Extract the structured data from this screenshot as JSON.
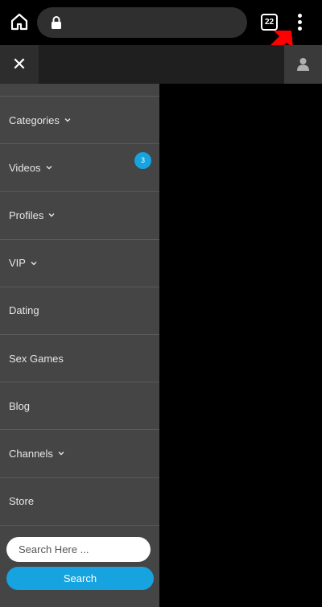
{
  "browser": {
    "tab_count": "22",
    "home_icon": "home-icon",
    "lock_icon": "lock-icon",
    "menu_icon": "more-vertical-icon",
    "annotation": "red-arrow-pointer"
  },
  "header": {
    "close_label": "✕",
    "user_icon": "user-icon"
  },
  "menu": {
    "items": [
      {
        "label": "Categories",
        "dropdown": true
      },
      {
        "label": "Videos",
        "dropdown": true,
        "badge": "3"
      },
      {
        "label": "Profiles",
        "dropdown": true
      },
      {
        "label": "VIP",
        "dropdown": true
      },
      {
        "label": "Dating",
        "dropdown": false
      },
      {
        "label": "Sex Games",
        "dropdown": false
      },
      {
        "label": "Blog",
        "dropdown": false
      },
      {
        "label": "Channels",
        "dropdown": true
      },
      {
        "label": "Store",
        "dropdown": false
      }
    ]
  },
  "search": {
    "placeholder": "Search Here ...",
    "value": "",
    "button_label": "Search"
  },
  "colors": {
    "accent": "#16a3df",
    "menu_bg": "#454545",
    "annotation": "#ff0000"
  }
}
